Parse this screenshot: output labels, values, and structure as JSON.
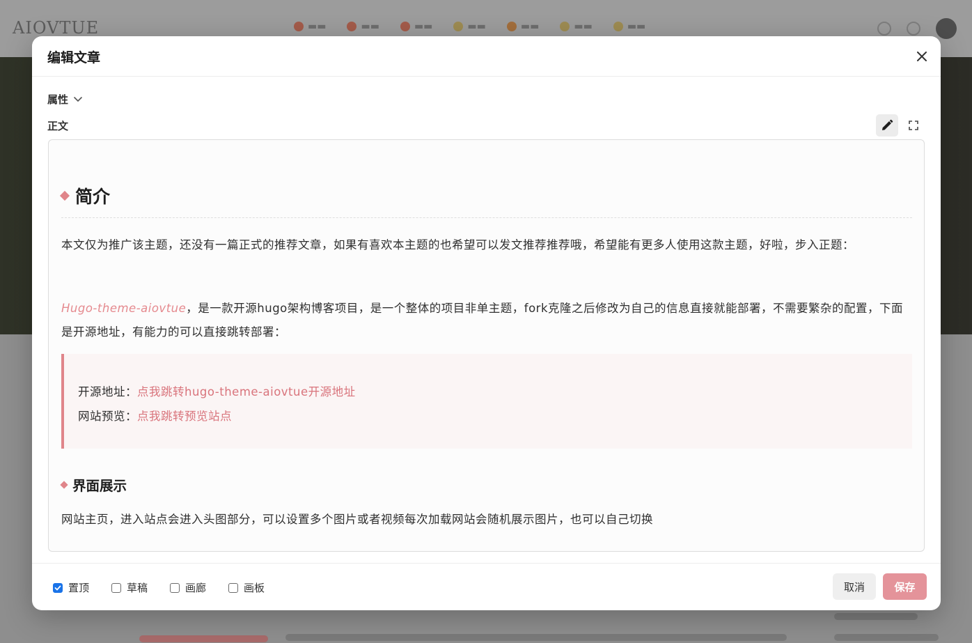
{
  "modal": {
    "title": "编辑文章",
    "properties_label": "属性",
    "body_label": "正文"
  },
  "article": {
    "heading": "简介",
    "intro": "本文仅为推广该主题，还没有一篇正式的推荐文章，如果有喜欢本主题的也希望可以发文推荐推荐哦，希望能有更多人使用这款主题，好啦，步入正题：",
    "theme_link": "Hugo-theme-aiovtue",
    "theme_desc": "，是一款开源hugo架构博客项目，是一个整体的项目非单主题，fork克隆之后修改为自己的信息直接就能部署，不需要繁杂的配置，下面是开源地址，有能力的可以直接跳转部署：",
    "source_label": "开源地址：",
    "source_link": "点我跳转hugo-theme-aiovtue开源地址",
    "preview_label": "网站预览：",
    "preview_link": "点我跳转预览站点",
    "subheading": "界面展示",
    "ui_desc": "网站主页，进入站点会进入头图部分，可以设置多个图片或者视频每次加载网站会随机展示图片，也可以自己切换"
  },
  "footer": {
    "options": [
      {
        "label": "置顶",
        "checked": true
      },
      {
        "label": "草稿",
        "checked": false
      },
      {
        "label": "画廊",
        "checked": false
      },
      {
        "label": "画板",
        "checked": false
      }
    ],
    "cancel_label": "取消",
    "save_label": "保存"
  },
  "colors": {
    "accent": "#e0858a",
    "save_button": "#e4939a",
    "checkbox_checked": "#1a73e8"
  }
}
